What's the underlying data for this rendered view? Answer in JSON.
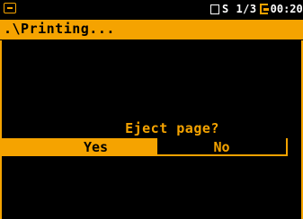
{
  "status_bar": {
    "status_text": "S 1/3",
    "time_text": "00:20",
    "accent_color": "#f5a300"
  },
  "title_bar": {
    "title": ".\\Printing..."
  },
  "dialog": {
    "question": "Eject page?",
    "yes_label": "Yes",
    "no_label": "No",
    "selected": "Yes"
  },
  "icons": {
    "menu": "menu-icon",
    "battery_or_square": "square-icon",
    "power": "plug-icon"
  }
}
